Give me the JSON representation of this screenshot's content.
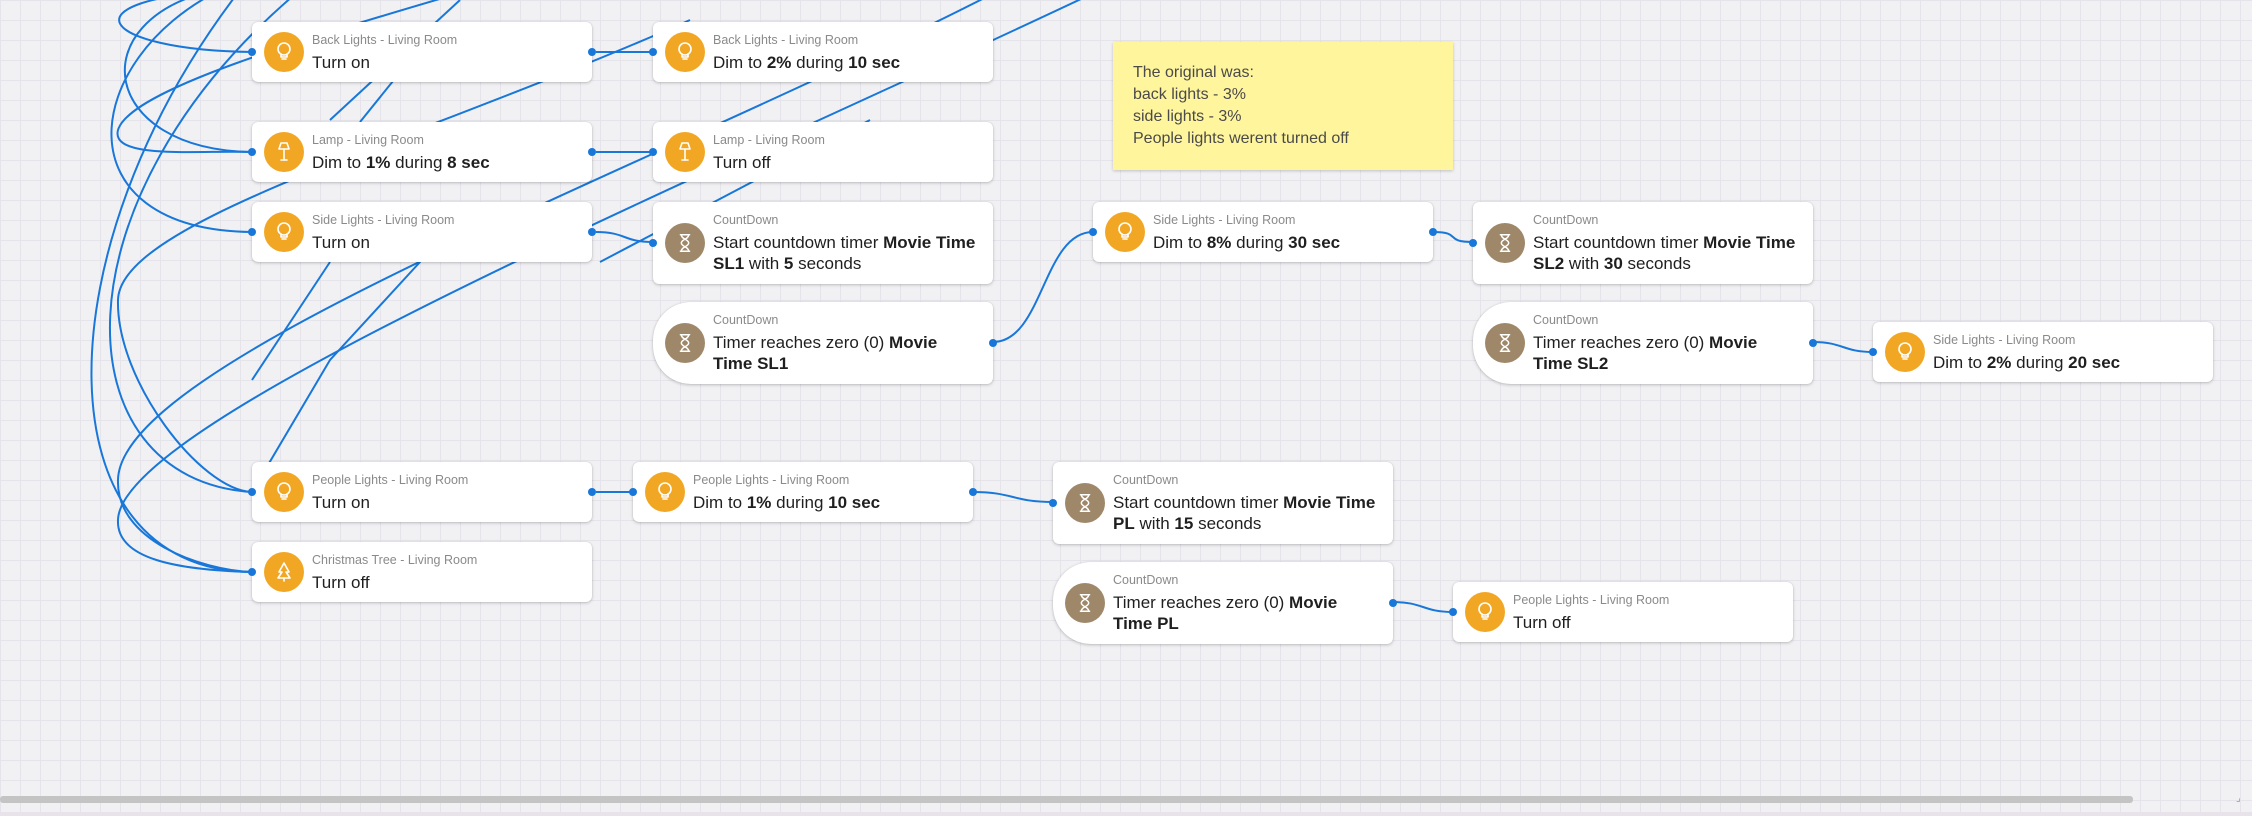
{
  "colors": {
    "wire": "#1877d8",
    "light_icon": "#f2a724",
    "timer_icon": "#9f886a",
    "note": "#fff59d"
  },
  "note": {
    "lines": [
      "The original was:",
      "back lights - 3%",
      "side lights - 3%",
      "People lights werent turned off"
    ]
  },
  "cards": [
    {
      "id": "back-on",
      "icon": "light-bulb-icon",
      "caption": "Back Lights - Living Room",
      "segments": [
        [
          "Turn on",
          false
        ]
      ]
    },
    {
      "id": "back-dim",
      "icon": "light-bulb-icon",
      "caption": "Back Lights - Living Room",
      "segments": [
        [
          "Dim to ",
          false
        ],
        [
          "2%",
          true
        ],
        [
          " during ",
          false
        ],
        [
          "10 sec",
          true
        ]
      ]
    },
    {
      "id": "lamp-dim",
      "icon": "floor-lamp-icon",
      "caption": "Lamp - Living Room",
      "segments": [
        [
          "Dim to ",
          false
        ],
        [
          "1%",
          true
        ],
        [
          " during ",
          false
        ],
        [
          "8 sec",
          true
        ]
      ]
    },
    {
      "id": "lamp-off",
      "icon": "floor-lamp-icon",
      "caption": "Lamp - Living Room",
      "segments": [
        [
          "Turn off",
          false
        ]
      ]
    },
    {
      "id": "side-on",
      "icon": "light-bulb-icon",
      "caption": "Side Lights - Living Room",
      "segments": [
        [
          "Turn on",
          false
        ]
      ]
    },
    {
      "id": "cd-sl1-start",
      "icon": "hourglass-icon",
      "caption": "CountDown",
      "segments": [
        [
          "Start countdown timer ",
          false
        ],
        [
          "Movie Time SL1",
          true
        ],
        [
          " with ",
          false
        ],
        [
          "5",
          true
        ],
        [
          " seconds",
          false
        ]
      ]
    },
    {
      "id": "cd-sl1-zero",
      "icon": "hourglass-icon",
      "caption": "CountDown",
      "segments": [
        [
          "Timer reaches zero (0) ",
          false
        ],
        [
          "Movie Time SL1",
          true
        ]
      ]
    },
    {
      "id": "side-dim8",
      "icon": "light-bulb-icon",
      "caption": "Side Lights - Living Room",
      "segments": [
        [
          "Dim to ",
          false
        ],
        [
          "8%",
          true
        ],
        [
          " during ",
          false
        ],
        [
          "30 sec",
          true
        ]
      ]
    },
    {
      "id": "cd-sl2-start",
      "icon": "hourglass-icon",
      "caption": "CountDown",
      "segments": [
        [
          "Start countdown timer ",
          false
        ],
        [
          "Movie Time SL2",
          true
        ],
        [
          " with ",
          false
        ],
        [
          "30",
          true
        ],
        [
          " seconds",
          false
        ]
      ]
    },
    {
      "id": "cd-sl2-zero",
      "icon": "hourglass-icon",
      "caption": "CountDown",
      "segments": [
        [
          "Timer reaches zero (0) ",
          false
        ],
        [
          "Movie Time SL2",
          true
        ]
      ]
    },
    {
      "id": "side-dim2",
      "icon": "light-bulb-icon",
      "caption": "Side Lights - Living Room",
      "segments": [
        [
          "Dim to ",
          false
        ],
        [
          "2%",
          true
        ],
        [
          " during ",
          false
        ],
        [
          "20 sec",
          true
        ]
      ]
    },
    {
      "id": "people-on",
      "icon": "light-bulb-icon",
      "caption": "People Lights - Living Room",
      "segments": [
        [
          "Turn on",
          false
        ]
      ]
    },
    {
      "id": "people-dim",
      "icon": "light-bulb-icon",
      "caption": "People Lights - Living Room",
      "segments": [
        [
          "Dim to ",
          false
        ],
        [
          "1%",
          true
        ],
        [
          " during ",
          false
        ],
        [
          "10 sec",
          true
        ]
      ]
    },
    {
      "id": "cd-pl-start",
      "icon": "hourglass-icon",
      "caption": "CountDown",
      "segments": [
        [
          "Start countdown timer ",
          false
        ],
        [
          "Movie Time PL",
          true
        ],
        [
          " with ",
          false
        ],
        [
          "15",
          true
        ],
        [
          " seconds",
          false
        ]
      ]
    },
    {
      "id": "cd-pl-zero",
      "icon": "hourglass-icon",
      "caption": "CountDown",
      "segments": [
        [
          "Timer reaches zero (0) ",
          false
        ],
        [
          "Movie Time PL",
          true
        ]
      ]
    },
    {
      "id": "people-off",
      "icon": "light-bulb-icon",
      "caption": "People Lights - Living Room",
      "segments": [
        [
          "Turn off",
          false
        ]
      ]
    },
    {
      "id": "xmas-off",
      "icon": "christmas-tree-icon",
      "caption": "Christmas Tree - Living Room",
      "segments": [
        [
          "Turn off",
          false
        ]
      ]
    }
  ]
}
